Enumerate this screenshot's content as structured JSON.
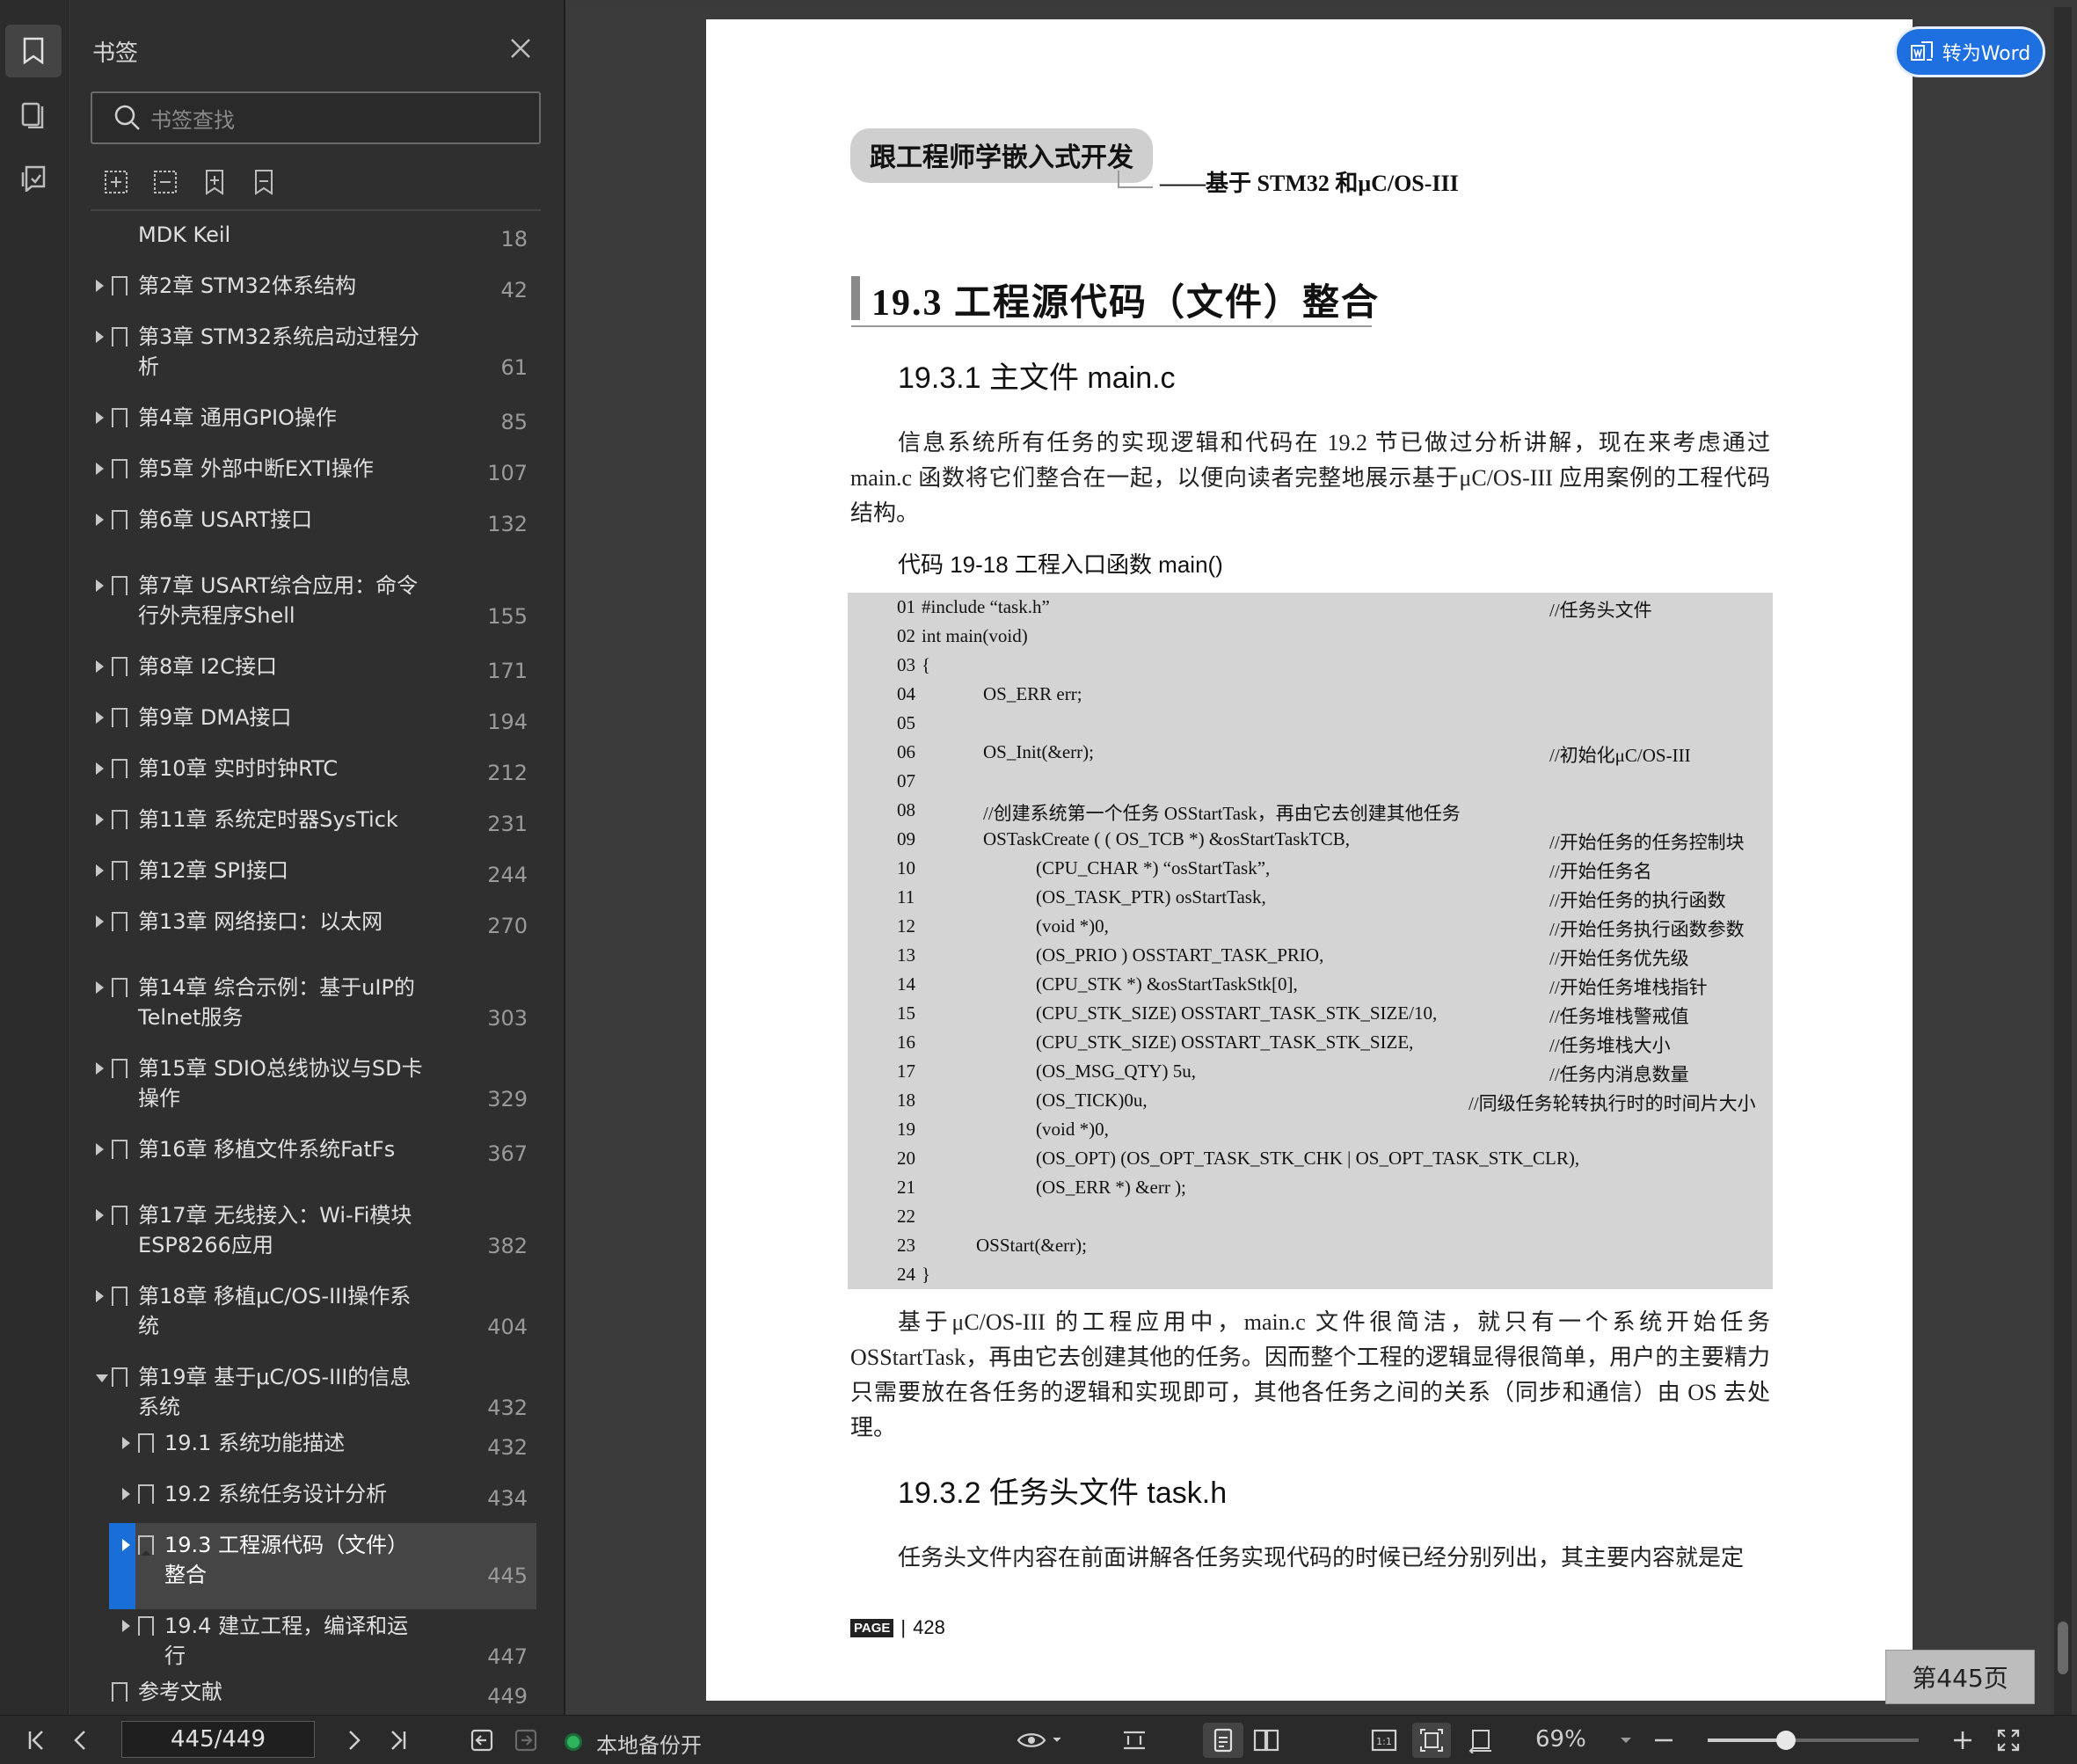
{
  "sidebar": {
    "title": "书签",
    "search_placeholder": "书签查找",
    "bookmarks": [
      {
        "label": "MDK Keil",
        "page": "18",
        "level": 0,
        "state": "partial"
      },
      {
        "label": "第2章  STM32体系结构",
        "page": "42",
        "level": 0,
        "state": "collapsed"
      },
      {
        "label": "第3章  STM32系统启动过程分析",
        "page": "61",
        "level": 0,
        "state": "collapsed"
      },
      {
        "label": "第4章  通用GPIO操作",
        "page": "85",
        "level": 0,
        "state": "collapsed"
      },
      {
        "label": "第5章  外部中断EXTI操作",
        "page": "107",
        "level": 0,
        "state": "collapsed"
      },
      {
        "label": "第6章  USART接口",
        "page": "132",
        "level": 0,
        "state": "collapsed"
      },
      {
        "label": "第7章  USART综合应用：命令行外壳程序Shell",
        "page": "155",
        "level": 0,
        "state": "collapsed"
      },
      {
        "label": "第8章  I2C接口",
        "page": "171",
        "level": 0,
        "state": "collapsed"
      },
      {
        "label": "第9章  DMA接口",
        "page": "194",
        "level": 0,
        "state": "collapsed"
      },
      {
        "label": "第10章  实时时钟RTC",
        "page": "212",
        "level": 0,
        "state": "collapsed"
      },
      {
        "label": "第11章  系统定时器SysTick",
        "page": "231",
        "level": 0,
        "state": "collapsed"
      },
      {
        "label": "第12章  SPI接口",
        "page": "244",
        "level": 0,
        "state": "collapsed"
      },
      {
        "label": "第13章  网络接口：以太网",
        "page": "270",
        "level": 0,
        "state": "collapsed"
      },
      {
        "label": "第14章  综合示例：基于uIP的Telnet服务",
        "page": "303",
        "level": 0,
        "state": "collapsed"
      },
      {
        "label": "第15章  SDIO总线协议与SD卡操作",
        "page": "329",
        "level": 0,
        "state": "collapsed"
      },
      {
        "label": "第16章  移植文件系统FatFs",
        "page": "367",
        "level": 0,
        "state": "collapsed"
      },
      {
        "label": "第17章  无线接入：Wi-Fi模块ESP8266应用",
        "page": "382",
        "level": 0,
        "state": "collapsed"
      },
      {
        "label": "第18章  移植μC/OS-III操作系统",
        "page": "404",
        "level": 0,
        "state": "collapsed"
      },
      {
        "label": "第19章  基于μC/OS-III的信息系统",
        "page": "432",
        "level": 0,
        "state": "expanded"
      },
      {
        "label": "19.1  系统功能描述",
        "page": "432",
        "level": 1,
        "state": "collapsed"
      },
      {
        "label": "19.2  系统任务设计分析",
        "page": "434",
        "level": 1,
        "state": "collapsed"
      },
      {
        "label": "19.3  工程源代码（文件）整合",
        "page": "445",
        "level": 1,
        "state": "collapsed",
        "active": true
      },
      {
        "label": "19.4  建立工程，编译和运行",
        "page": "447",
        "level": 1,
        "state": "collapsed"
      },
      {
        "label": "参考文献",
        "page": "449",
        "level": 0,
        "state": "none"
      }
    ]
  },
  "document": {
    "book_title": "跟工程师学嵌入式开发",
    "book_subtitle": "——基于 STM32 和μC/OS-III",
    "section_title": "19.3   工程源代码（文件）整合",
    "subsection1": "19.3.1   主文件 main.c",
    "para1": "信息系统所有任务的实现逻辑和代码在 19.2 节已做过分析讲解，现在来考虑通过 main.c 函数将它们整合在一起，以便向读者完整地展示基于μC/OS-III 应用案例的工程代码结构。",
    "code_caption": "代码 19-18   工程入口函数 main()",
    "code_lines": [
      {
        "n": "01",
        "code": "#include “task.h”",
        "indent": 0,
        "comment": "//任务头文件"
      },
      {
        "n": "02",
        "code": "int main(void)",
        "indent": 0,
        "comment": ""
      },
      {
        "n": "03",
        "code": "{",
        "indent": 0,
        "comment": ""
      },
      {
        "n": "04",
        "code": "OS_ERR err;",
        "indent": 1,
        "comment": ""
      },
      {
        "n": "05",
        "code": "",
        "indent": 0,
        "comment": ""
      },
      {
        "n": "06",
        "code": "OS_Init(&err);",
        "indent": 1,
        "comment": "//初始化μC/OS-III"
      },
      {
        "n": "07",
        "code": "",
        "indent": 0,
        "comment": ""
      },
      {
        "n": "08",
        "code": "//创建系统第一个任务 OSStartTask，再由它去创建其他任务",
        "indent": 1,
        "comment": ""
      },
      {
        "n": "09",
        "code": "OSTaskCreate ( ( OS_TCB *) &osStartTaskTCB,",
        "indent": 1,
        "comment": "//开始任务的任务控制块"
      },
      {
        "n": "10",
        "code": "(CPU_CHAR *) “osStartTask”,",
        "indent": 2,
        "comment": "//开始任务名"
      },
      {
        "n": "11",
        "code": "(OS_TASK_PTR) osStartTask,",
        "indent": 2,
        "comment": "//开始任务的执行函数"
      },
      {
        "n": "12",
        "code": "(void *)0,",
        "indent": 2,
        "comment": "//开始任务执行函数参数"
      },
      {
        "n": "13",
        "code": "(OS_PRIO ) OSSTART_TASK_PRIO,",
        "indent": 2,
        "comment": "//开始任务优先级"
      },
      {
        "n": "14",
        "code": "(CPU_STK *) &osStartTaskStk[0],",
        "indent": 2,
        "comment": "//开始任务堆栈指针"
      },
      {
        "n": "15",
        "code": "(CPU_STK_SIZE) OSSTART_TASK_STK_SIZE/10,",
        "indent": 2,
        "comment": "//任务堆栈警戒值"
      },
      {
        "n": "16",
        "code": "(CPU_STK_SIZE) OSSTART_TASK_STK_SIZE,",
        "indent": 2,
        "comment": "//任务堆栈大小"
      },
      {
        "n": "17",
        "code": "(OS_MSG_QTY) 5u,",
        "indent": 2,
        "comment": "//任务内消息数量"
      },
      {
        "n": "18",
        "code": "(OS_TICK)0u,",
        "indent": 2,
        "comment": "//同级任务轮转执行时的时间片大小",
        "comment_pos": "left"
      },
      {
        "n": "19",
        "code": "(void *)0,",
        "indent": 2,
        "comment": ""
      },
      {
        "n": "20",
        "code": "(OS_OPT) (OS_OPT_TASK_STK_CHK | OS_OPT_TASK_STK_CLR),",
        "indent": 2,
        "comment": ""
      },
      {
        "n": "21",
        "code": "(OS_ERR *) &err );",
        "indent": 2,
        "comment": ""
      },
      {
        "n": "22",
        "code": "",
        "indent": 0,
        "comment": ""
      },
      {
        "n": "23",
        "code": "OSStart(&err);",
        "indent": 3,
        "comment": ""
      },
      {
        "n": "24",
        "code": "}",
        "indent": 0,
        "comment": ""
      }
    ],
    "para2": "基于μC/OS-III 的工程应用中，main.c 文件很简洁，就只有一个系统开始任务 OSStartTask，再由它去创建其他的任务。因而整个工程的逻辑显得很简单，用户的主要精力只需要放在各任务的逻辑和实现即可，其他各任务之间的关系（同步和通信）由 OS 去处理。",
    "subsection2": "19.3.2   任务头文件 task.h",
    "para3": "任务头文件内容在前面讲解各任务实现代码的时候已经分别列出，其主要内容就是定",
    "page_tag": "PAGE",
    "page_number": "428"
  },
  "overlay": {
    "to_word": "转为Word",
    "page_indicator": "第445页"
  },
  "toolbar": {
    "page_input": "445/449",
    "backup_label": "本地备份开",
    "zoom": "69%",
    "zoom_level": 0.37
  },
  "colors": {
    "accent": "#1e6fe0",
    "panel_bg": "#2f2f2f",
    "code_bg": "#d4d4d4",
    "backup_green": "#2fb35c"
  }
}
